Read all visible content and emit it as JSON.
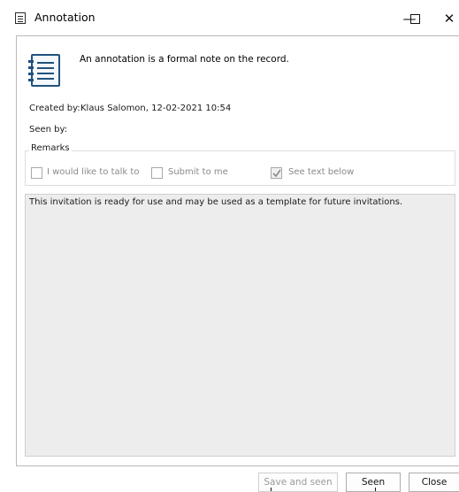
{
  "window": {
    "title": "Annotation",
    "minimize_glyph": "—",
    "close_glyph": "✕"
  },
  "header": {
    "icon": "notebook-icon",
    "description": "An annotation is a formal note on the record."
  },
  "details": {
    "created_by_label": "Created by:",
    "created_by_value": "Klaus Salomon, 12-02-2021 10:54",
    "seen_by_label": "Seen by:"
  },
  "remarks": {
    "group_title": "Remarks",
    "options": [
      {
        "label": "I would like to talk to",
        "checked": false
      },
      {
        "label": "Submit to me",
        "checked": false
      },
      {
        "label": "See text below",
        "checked": true
      }
    ]
  },
  "note": {
    "text": "This invitation is ready for use and may be used as a template for future invitations."
  },
  "buttons": {
    "save_and_seen": "Save and seen",
    "seen": "Seen",
    "close": "Close"
  },
  "colors": {
    "icon_blue": "#21527e",
    "text_area_bg": "#ededed",
    "disabled_text": "#8a8a8a"
  }
}
